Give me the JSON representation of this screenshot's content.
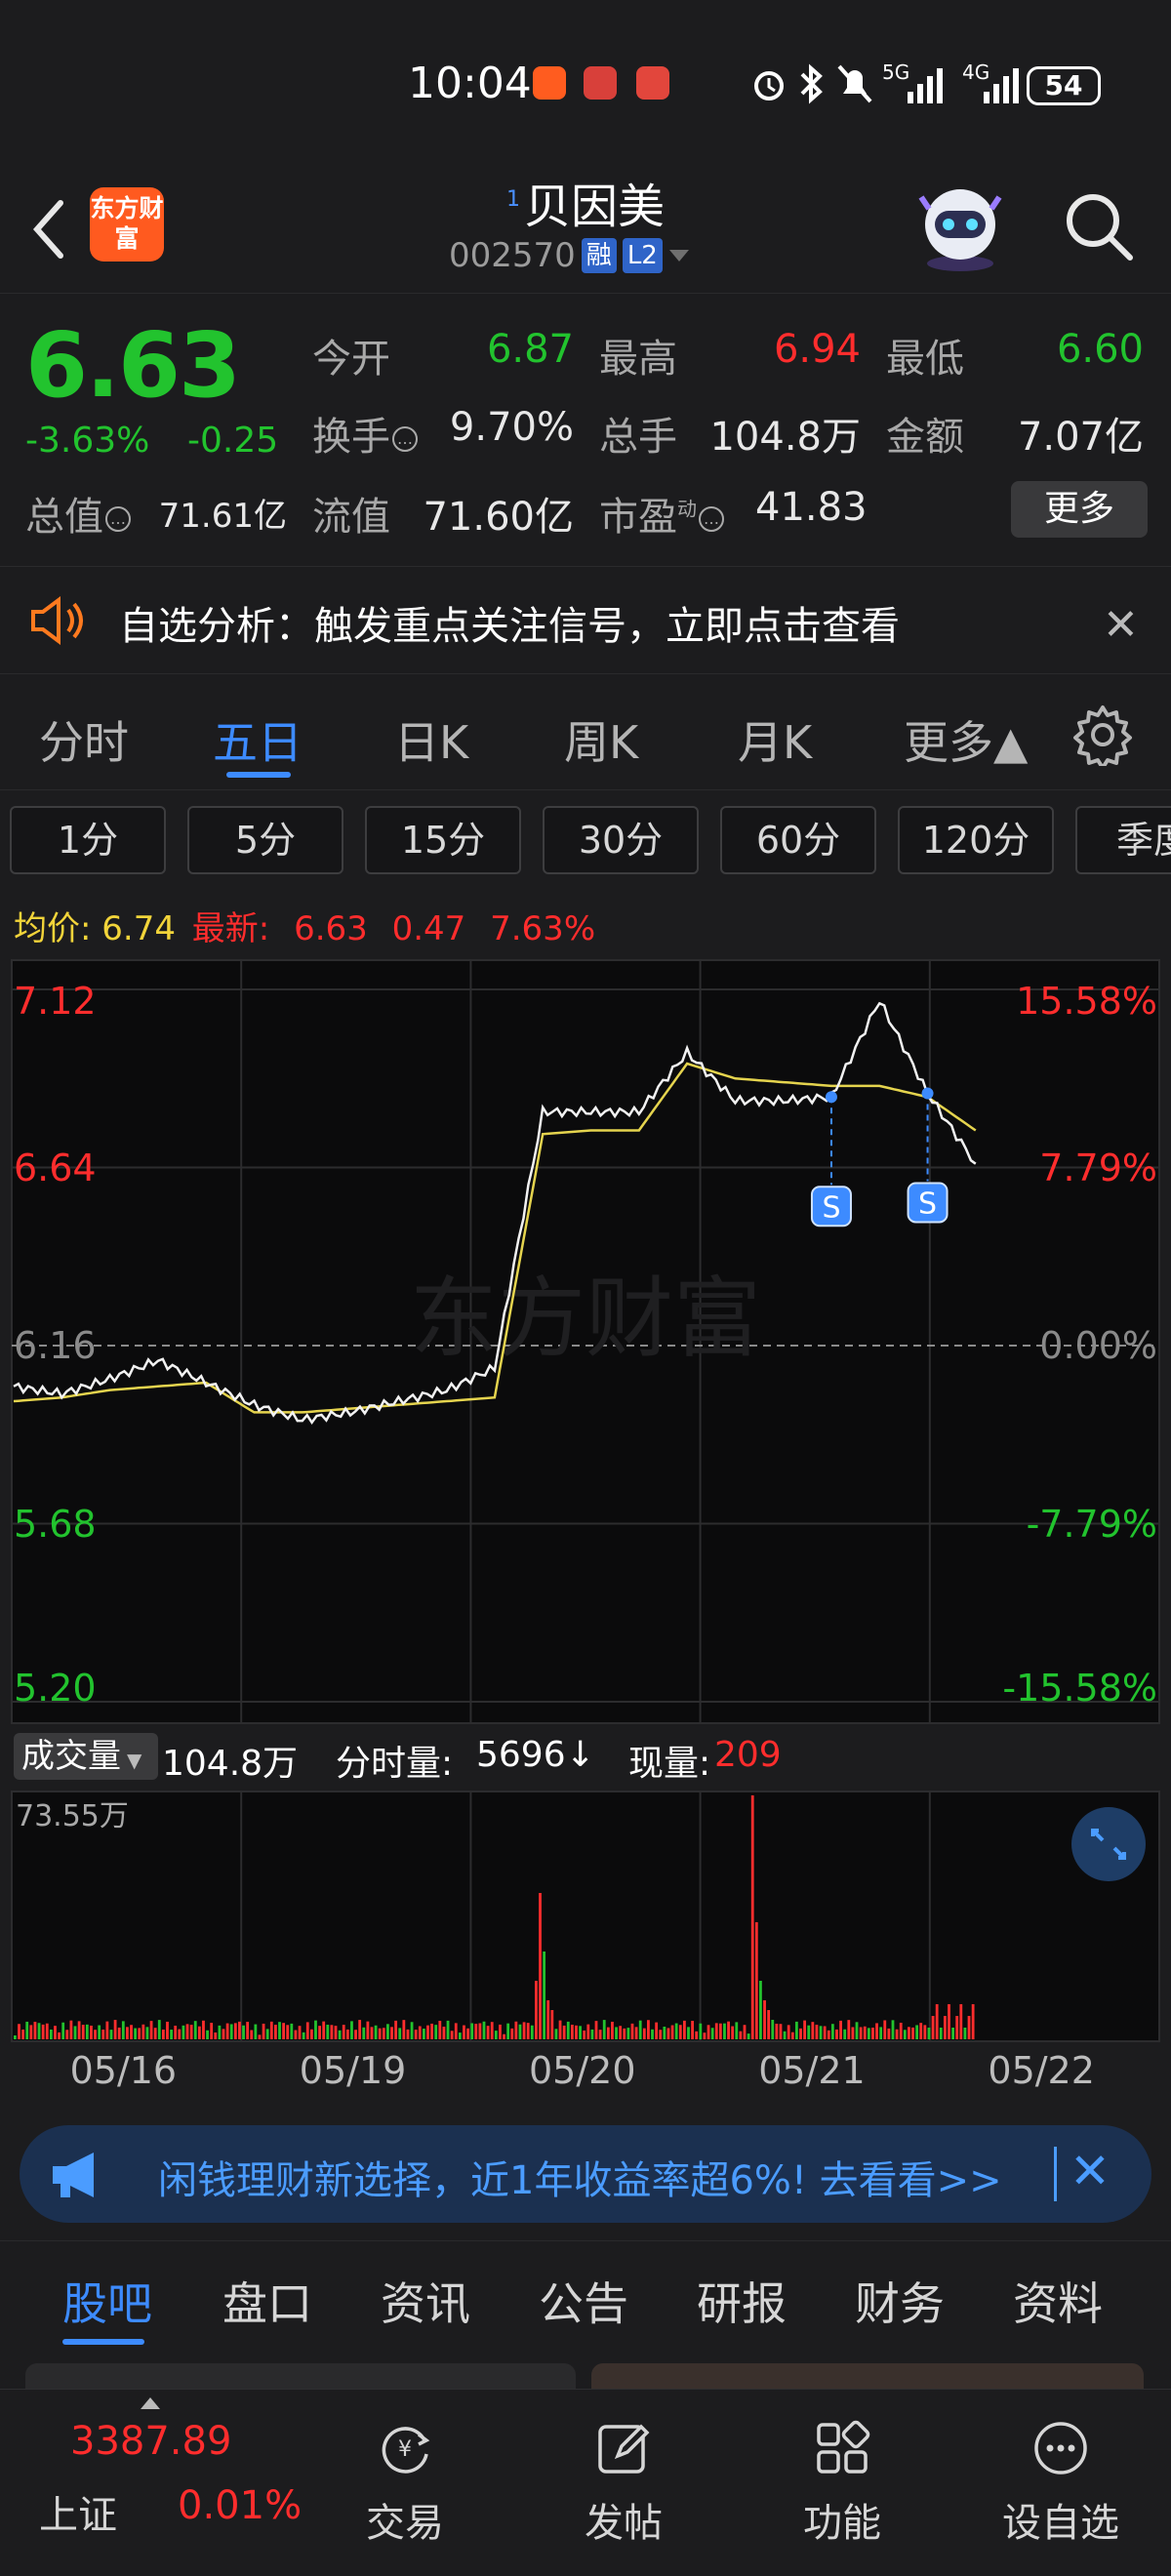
{
  "status_bar": {
    "time": "10:04",
    "network_5g": "5G",
    "network_4g": "4G",
    "battery": "54"
  },
  "header": {
    "logo_text": "东方财富",
    "superscript": "1",
    "stock_name": "贝因美",
    "stock_code": "002570",
    "tag_margin": "融",
    "tag_level": "L2"
  },
  "quote": {
    "price": "6.63",
    "change_pct": "-3.63%",
    "change_amt": "-0.25",
    "open_label": "今开",
    "open": "6.87",
    "high_label": "最高",
    "high": "6.94",
    "low_label": "最低",
    "low": "6.60",
    "turnover_label": "换手",
    "turnover": "9.70%",
    "volume_label": "总手",
    "volume": "104.8万",
    "amount_label": "金额",
    "amount": "7.07亿",
    "mktcap_label": "总值",
    "mktcap": "71.61亿",
    "float_label": "流值",
    "float_cap": "71.60亿",
    "pe_label": "市盈",
    "pe_sup": "动",
    "pe": "41.83",
    "more_label": "更多"
  },
  "banner": {
    "text": "自选分析：触发重点关注信号，立即点击查看"
  },
  "period_tabs": [
    "分时",
    "五日",
    "日K",
    "周K",
    "月K",
    "更多▲"
  ],
  "interval_buttons": [
    "1分",
    "5分",
    "15分",
    "30分",
    "60分",
    "120分",
    "季度"
  ],
  "avg_info": {
    "avg_label": "均价:",
    "avg_value": "6.74",
    "latest_label": "最新:",
    "latest_price": "6.63",
    "latest_change": "0.47",
    "latest_pct": "7.63%"
  },
  "chart_data": {
    "type": "line",
    "title": "",
    "x": [
      "05/16",
      "05/19",
      "05/20",
      "05/21",
      "05/22"
    ],
    "y_left_ticks": [
      "7.12",
      "6.64",
      "6.16",
      "5.68",
      "5.20"
    ],
    "y_right_ticks": [
      "15.58%",
      "7.79%",
      "0.00%",
      "-7.79%",
      "-15.58%"
    ],
    "ylim": [
      5.2,
      7.12
    ],
    "reference_price": 6.16,
    "watermark": "东方财富",
    "series": [
      {
        "values": [
          6.05,
          6.03,
          6.07,
          6.12,
          6.06,
          6.0,
          5.96,
          5.98,
          6.01,
          6.04,
          6.1,
          6.79,
          6.79,
          6.79,
          6.95,
          6.82,
          6.82,
          6.83,
          7.09,
          6.84,
          6.65
        ]
      },
      {
        "values": [
          6.01,
          6.02,
          6.04,
          6.05,
          6.06,
          5.98,
          5.98,
          5.99,
          6.0,
          6.01,
          6.02,
          6.73,
          6.74,
          6.74,
          6.92,
          6.88,
          6.87,
          6.86,
          6.86,
          6.83,
          6.74
        ]
      }
    ],
    "markers": [
      {
        "label": "S",
        "x_index": 17
      },
      {
        "label": "S",
        "x_index": 19
      }
    ]
  },
  "volume": {
    "select_label": "成交量",
    "total": "104.8万",
    "period_label": "分时量:",
    "period_value": "5696↓",
    "now_label": "现量:",
    "now_value": "209",
    "max_label": "73.55万"
  },
  "ad": {
    "text": "闲钱理财新选择，近1年收益率超6%! 去看看>>"
  },
  "bottom_tabs": [
    "股吧",
    "盘口",
    "资讯",
    "公告",
    "研报",
    "财务",
    "资料"
  ],
  "bottom_nav": {
    "index_value": "3387.89",
    "index_name": "上证",
    "index_pct": "0.01%",
    "items": [
      "交易",
      "发帖",
      "功能",
      "设自选"
    ]
  }
}
